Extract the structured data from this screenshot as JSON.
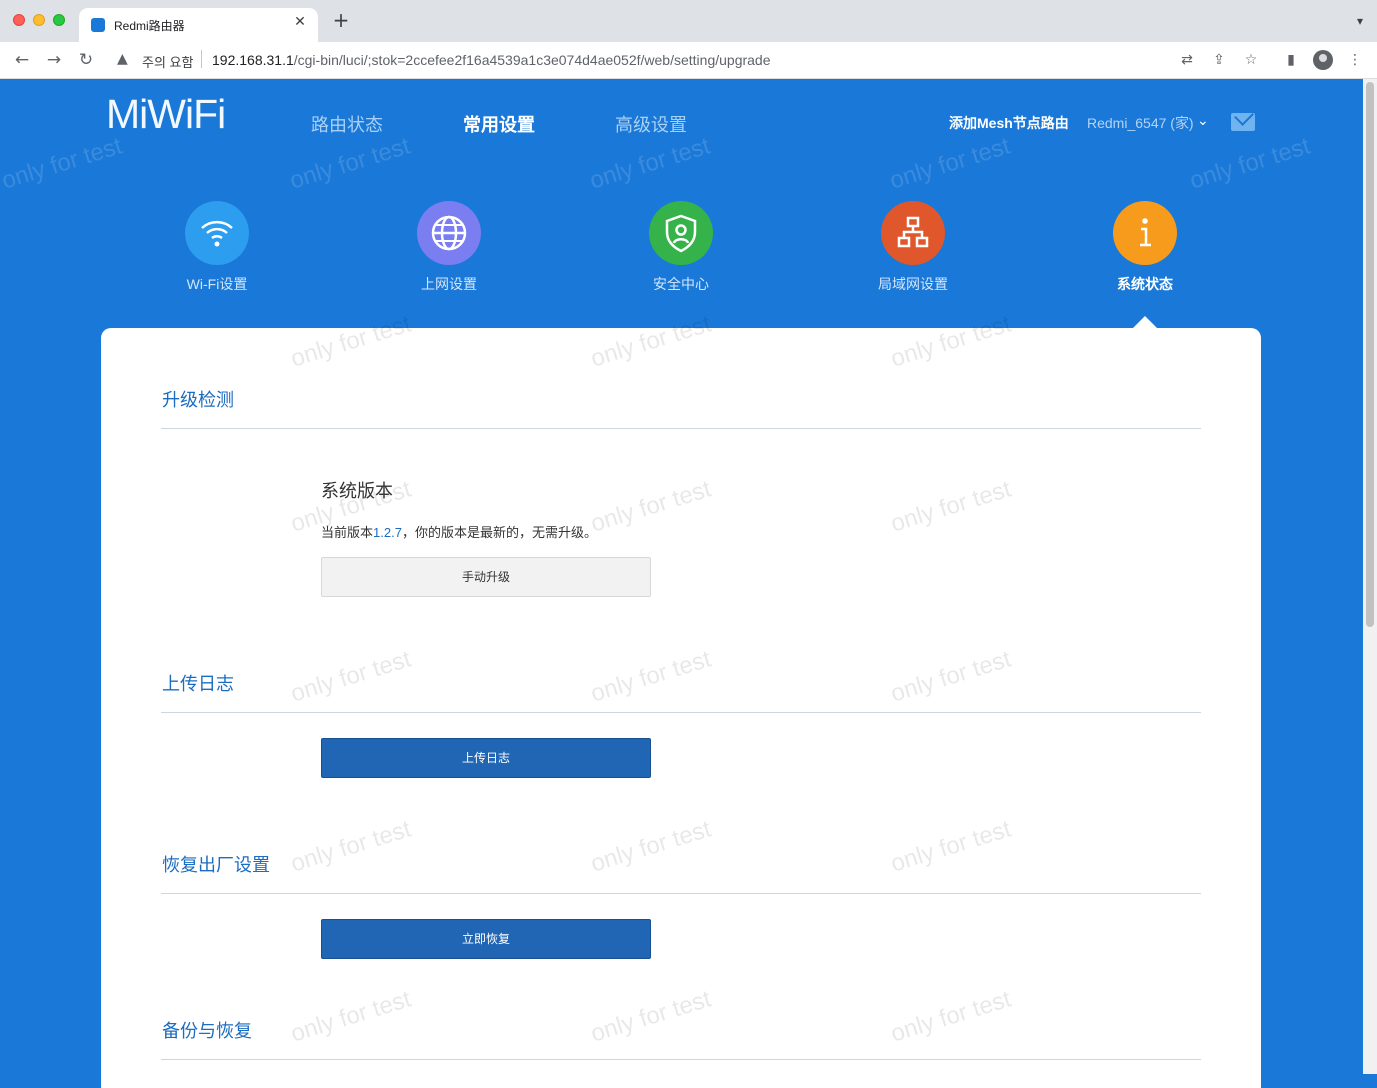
{
  "browser": {
    "tab_title": "Redmi路由器",
    "tab_close": "✕",
    "new_tab": "+",
    "security_label": "주의 요함",
    "url_host": "192.168.31.1",
    "url_path": "/cgi-bin/luci/;stok=2ccefee2f16a4539a1c3e074d4ae052f/web/setting/upgrade"
  },
  "header": {
    "logo": "MiWiFi",
    "nav": [
      "路由状态",
      "常用设置",
      "高级设置"
    ],
    "active_nav": "常用设置",
    "mesh_link": "添加Mesh节点路由",
    "router_name": "Redmi_6547 (家)"
  },
  "categories": [
    {
      "label": "Wi-Fi设置",
      "icon": "wifi-icon",
      "color": "#2d9df0"
    },
    {
      "label": "上网设置",
      "icon": "globe-icon",
      "color": "#7a7ef0"
    },
    {
      "label": "安全中心",
      "icon": "shield-icon",
      "color": "#35b34a"
    },
    {
      "label": "局域网设置",
      "icon": "network-icon",
      "color": "#e0572b"
    },
    {
      "label": "系统状态",
      "icon": "info-icon",
      "color": "#f79b1c"
    }
  ],
  "active_category": "系统状态",
  "sections": {
    "upgrade": {
      "title": "升级检测",
      "version_title": "系统版本",
      "desc_prefix": "当前版本",
      "version": "1.2.7",
      "desc_suffix": "，你的版本是最新的，无需升级。",
      "button": "手动升级"
    },
    "log": {
      "title": "上传日志",
      "button": "上传日志"
    },
    "reset": {
      "title": "恢复出厂设置",
      "button": "立即恢复"
    },
    "backup": {
      "title": "备份与恢复"
    }
  },
  "watermark": "only for test",
  "colors": {
    "brand_blue": "#1a78d8",
    "link_blue": "#1b6dc1",
    "button_blue": "#2165b5"
  }
}
